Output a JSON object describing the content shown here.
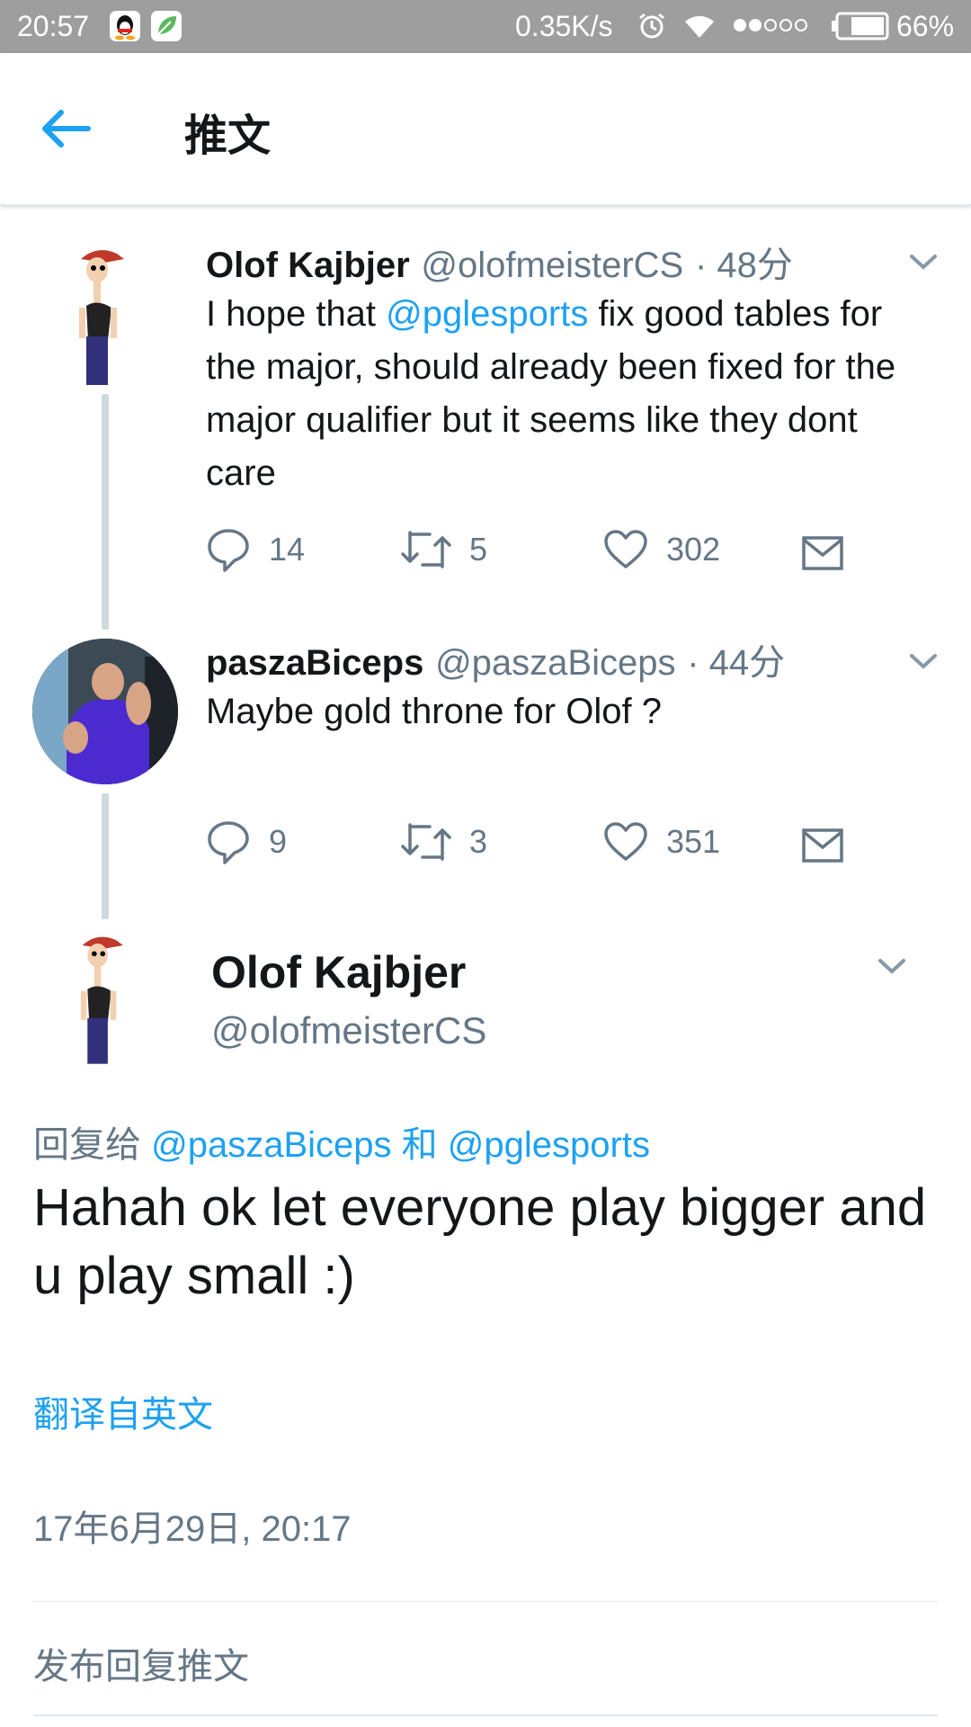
{
  "status_bar": {
    "time": "20:57",
    "network_speed": "0.35K/s",
    "battery": "66%",
    "bg_color": "#9e9e9e"
  },
  "header": {
    "back_icon": "arrow-left-icon",
    "title": "推文"
  },
  "colors": {
    "accent": "#1da1f2",
    "text": "#14171a",
    "secondary_text": "#657786"
  },
  "thread": [
    {
      "name": "Olof Kajbjer",
      "handle": "@olofmeisterCS",
      "time": "· 48分",
      "text_parts": [
        "I hope that ",
        "@pglesports",
        " fix good tables for the major, should already been fixed for the major qualifier but it seems like they dont care"
      ],
      "actions": {
        "replies": "14",
        "retweets": "5",
        "likes": "302"
      }
    },
    {
      "name": "paszaBiceps",
      "handle": "@paszaBiceps",
      "time": "· 44分",
      "text": "Maybe gold throne for Olof ?",
      "actions": {
        "replies": "9",
        "retweets": "3",
        "likes": "351"
      }
    }
  ],
  "focus_tweet": {
    "name": "Olof Kajbjer",
    "handle": "@olofmeisterCS",
    "reply_prefix": "回复给",
    "reply_mention_1": "@paszaBiceps",
    "reply_and": "和",
    "reply_mention_2": "@pglesports",
    "text": "Hahah ok let everyone play bigger and u play small :)",
    "translate": "翻译自英文",
    "timestamp": "17年6月29日, 20:17"
  },
  "reply_box": {
    "placeholder": "发布回复推文"
  }
}
